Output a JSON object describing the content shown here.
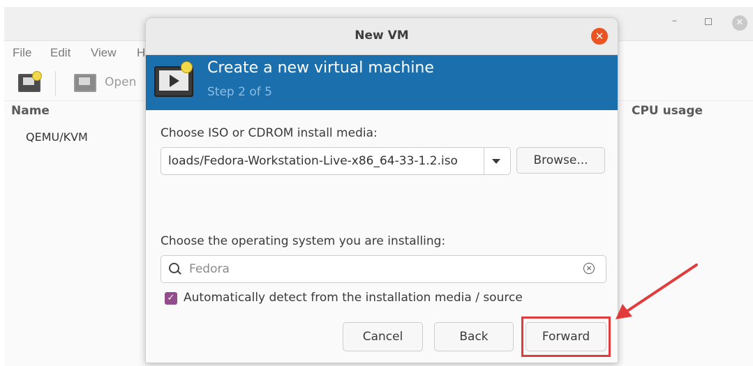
{
  "background_window": {
    "menu": [
      "File",
      "Edit",
      "View",
      "H"
    ],
    "toolbar": {
      "open_label": "Open"
    },
    "columns": {
      "name": "Name",
      "cpu": "CPU usage"
    },
    "connections": [
      "QEMU/KVM"
    ],
    "controls": {
      "minimize": "–",
      "close": "✕"
    }
  },
  "dialog": {
    "title": "New VM",
    "close_glyph": "✕",
    "banner": {
      "title": "Create a new virtual machine",
      "step": "Step 2 of 5"
    },
    "media": {
      "label": "Choose ISO or CDROM install media:",
      "value": "loads/Fedora-Workstation-Live-x86_64-33-1.2.iso",
      "browse_label": "Browse..."
    },
    "os": {
      "label": "Choose the operating system you are installing:",
      "search_value": "Fedora",
      "clear_glyph": "×"
    },
    "autodetect": {
      "checked": true,
      "check_glyph": "✓",
      "label": "Automatically detect from the installation media / source"
    },
    "buttons": {
      "cancel": "Cancel",
      "back": "Back",
      "forward": "Forward"
    }
  },
  "colors": {
    "banner": "#1b6fac",
    "close_button": "#e95420",
    "checkbox": "#924d8b",
    "annotation": "#e23b3b"
  }
}
